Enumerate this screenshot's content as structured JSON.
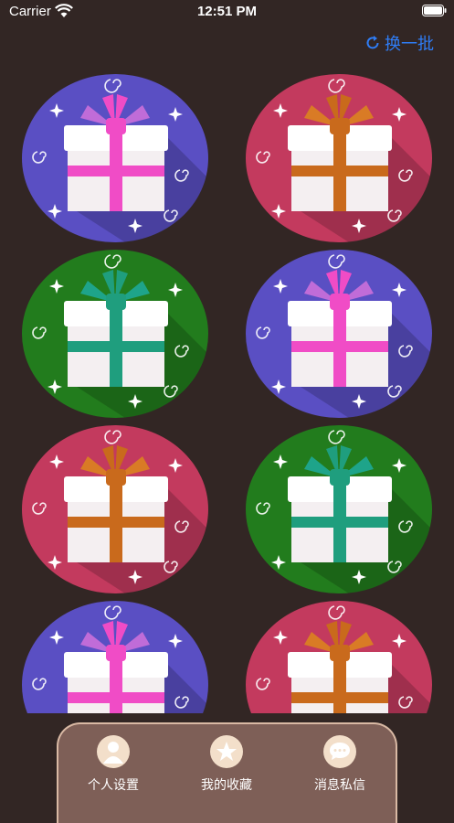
{
  "status_bar": {
    "carrier": "Carrier",
    "time": "12:51 PM"
  },
  "header": {
    "refresh_label": "换一批"
  },
  "gifts": [
    {
      "color": "#5a4fc3",
      "ribbon": "#f04cc6",
      "bow": "#c06cd8"
    },
    {
      "color": "#c33a5e",
      "ribbon": "#c96a1c",
      "bow": "#d97b25"
    },
    {
      "color": "#227c1d",
      "ribbon": "#1f9e7e",
      "bow": "#1ea48a"
    },
    {
      "color": "#5a4fc3",
      "ribbon": "#f04cc6",
      "bow": "#c06cd8"
    },
    {
      "color": "#c33a5e",
      "ribbon": "#c96a1c",
      "bow": "#d97b25"
    },
    {
      "color": "#227c1d",
      "ribbon": "#1f9e7e",
      "bow": "#1ea48a"
    },
    {
      "color": "#5a4fc3",
      "ribbon": "#f04cc6",
      "bow": "#c06cd8"
    },
    {
      "color": "#c33a5e",
      "ribbon": "#c96a1c",
      "bow": "#d97b25"
    }
  ],
  "tabbar": {
    "items": [
      {
        "label": "个人设置",
        "icon": "user-icon"
      },
      {
        "label": "我的收藏",
        "icon": "star-icon"
      },
      {
        "label": "消息私信",
        "icon": "chat-icon"
      }
    ]
  }
}
